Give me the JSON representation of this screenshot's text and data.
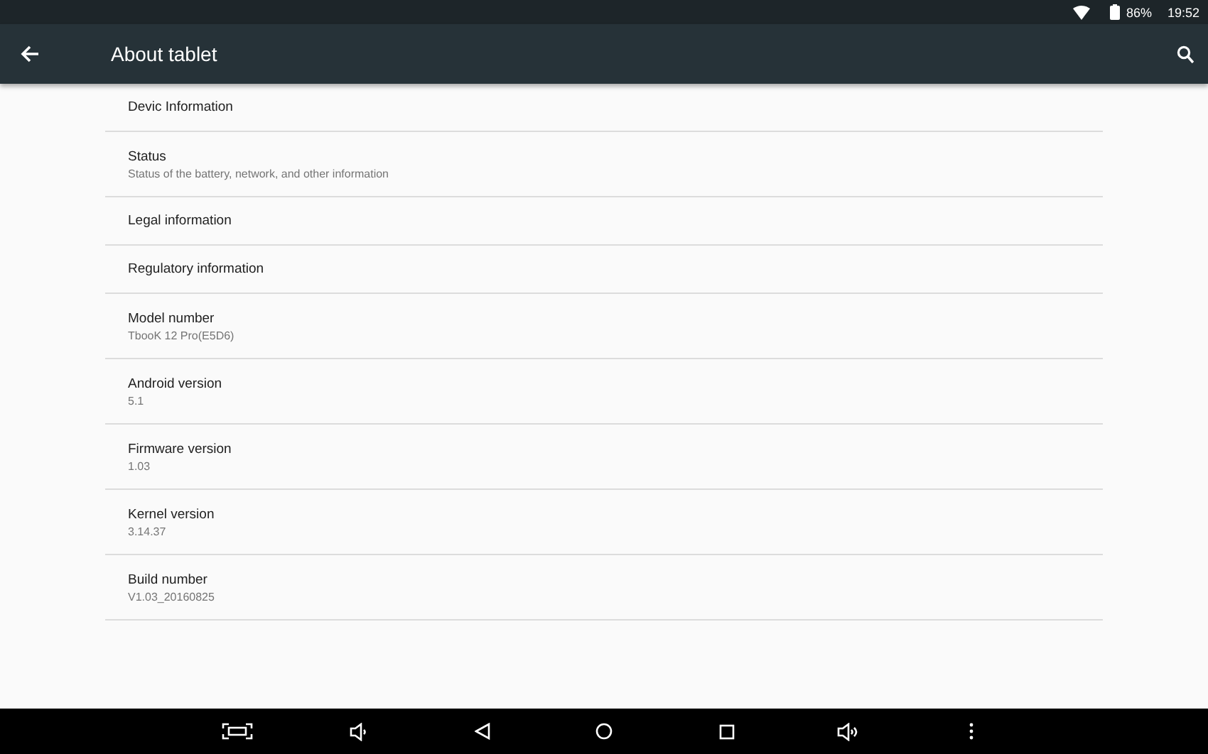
{
  "status_bar": {
    "battery": "86%",
    "time": "19:52"
  },
  "app_bar": {
    "title": "About tablet"
  },
  "items": [
    {
      "title": "Devic Information"
    },
    {
      "title": "Status",
      "summary": "Status of the battery, network, and other information"
    },
    {
      "title": "Legal information"
    },
    {
      "title": "Regulatory information"
    },
    {
      "title": "Model number",
      "summary": "TbooK 12 Pro(E5D6)"
    },
    {
      "title": "Android version",
      "summary": "5.1"
    },
    {
      "title": "Firmware version",
      "summary": "1.03"
    },
    {
      "title": "Kernel version",
      "summary": "3.14.37"
    },
    {
      "title": "Build number",
      "summary": "V1.03_20160825"
    }
  ]
}
